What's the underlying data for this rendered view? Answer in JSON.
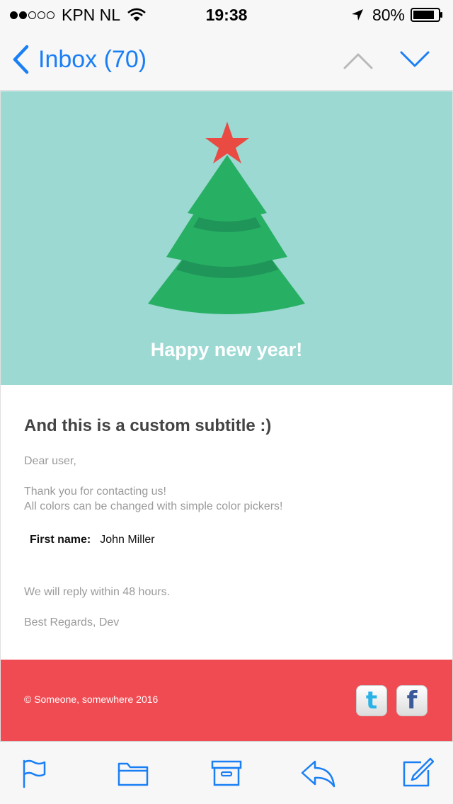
{
  "status_bar": {
    "carrier": "KPN NL",
    "time": "19:38",
    "battery": "80%",
    "signal_bars_filled": 2,
    "signal_bars_total": 5
  },
  "nav": {
    "back_label": "Inbox (70)"
  },
  "email": {
    "hero_title": "Happy new year!",
    "subtitle": "And this is a custom subtitle :)",
    "greeting": "Dear user,",
    "body_line1": "Thank you for contacting us!",
    "body_line2": "All colors can be changed with simple color pickers!",
    "field_label": "First name:",
    "field_value": "John Miller",
    "reply_note": "We will reply within 48 hours.",
    "signoff": "Best Regards, Dev",
    "copyright": "© Someone, somewhere 2016",
    "twitter_glyph": "t",
    "facebook_glyph": "f"
  },
  "colors": {
    "accent": "#1a7ff5",
    "hero_bg": "#9bd9d2",
    "tree_green": "#27b063",
    "star_red": "#e94b43",
    "footer_bg": "#f04b52"
  },
  "icons": {
    "toolbar": [
      "flag-icon",
      "folder-icon",
      "archive-icon",
      "reply-icon",
      "compose-icon"
    ]
  }
}
